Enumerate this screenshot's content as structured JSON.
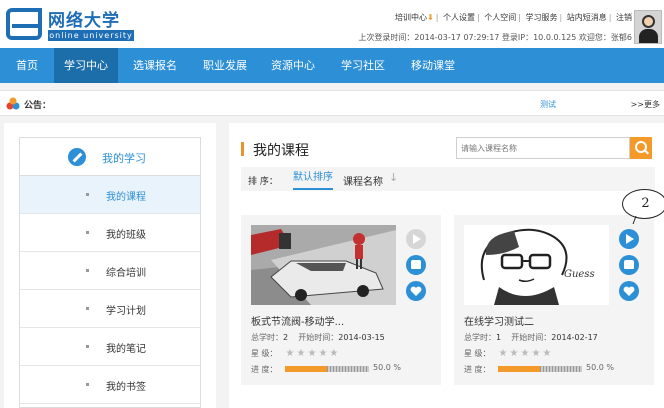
{
  "logo": {
    "title": "网络大学",
    "subtitle": "online university"
  },
  "toplinks": [
    "培训中心",
    "个人设置",
    "个人空间",
    "学习服务",
    "站内短消息",
    "注销"
  ],
  "login_info": "上次登录时间：2014-03-17 07:29:17  登录IP：10.0.0.125  欢迎您：张郁6",
  "nav": {
    "items": [
      "首页",
      "学习中心",
      "选课报名",
      "职业发展",
      "资源中心",
      "学习社区",
      "移动课堂"
    ],
    "active": "学习中心"
  },
  "notice": {
    "label": "公告：",
    "text": "测试",
    "more": ">>更多"
  },
  "sidebar": {
    "title": "我的学习",
    "items": [
      "我的课程",
      "我的班级",
      "综合培训",
      "学习计划",
      "我的笔记",
      "我的书签"
    ],
    "active": "我的课程"
  },
  "main": {
    "title": "我的课程",
    "search_placeholder": "请输入课程名称",
    "sort_label": "排  序：",
    "sort_default": "默认排序",
    "sort_name": "课程名称",
    "sort_arrow": "↓"
  },
  "labels": {
    "hours": "总学时：",
    "start": "开始时间：",
    "stars": "星   级：",
    "progress": "进   度："
  },
  "courses": [
    {
      "title": "板式节流阀-移动学...",
      "hours": "2",
      "start": "2014-03-15",
      "progress": 50.0,
      "progress_text": "50.0 %"
    },
    {
      "title": "在线学习测试二",
      "hours": "1",
      "start": "2014-02-17",
      "progress": 50.0,
      "progress_text": "50.0 %"
    }
  ],
  "callout": "2",
  "colors": {
    "primary": "#2d8fd6",
    "nav_active": "#1c6eaa",
    "accent": "#f39a2b"
  }
}
